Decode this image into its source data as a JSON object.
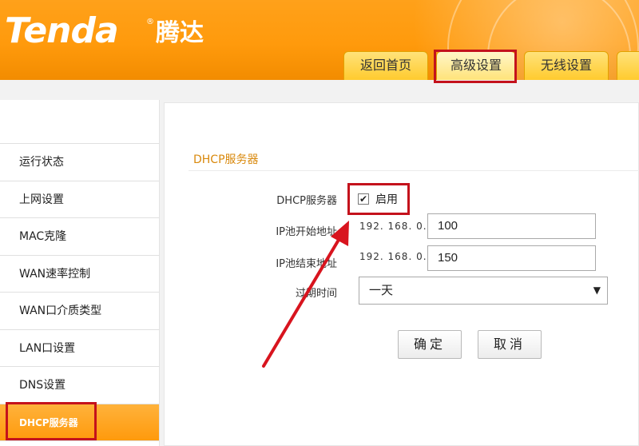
{
  "brand": {
    "logo_text": "Tenda",
    "logo_cn": "腾达",
    "reg_mark": "®"
  },
  "tabs": [
    {
      "label": "返回首页",
      "active": false
    },
    {
      "label": "高级设置",
      "active": true
    },
    {
      "label": "无线设置",
      "active": false
    },
    {
      "label": "",
      "active": false
    }
  ],
  "sidebar": {
    "items": [
      {
        "label": "运行状态"
      },
      {
        "label": "上网设置"
      },
      {
        "label": "MAC克隆"
      },
      {
        "label": "WAN速率控制"
      },
      {
        "label": "WAN口介质类型"
      },
      {
        "label": "LAN口设置"
      },
      {
        "label": "DNS设置"
      },
      {
        "label": "DHCP服务器",
        "active": true
      }
    ]
  },
  "main": {
    "section_title": "DHCP服务器",
    "dhcp_label": "DHCP服务器",
    "enable_label": "启用",
    "enable_checked": true,
    "ip_start_label": "IP池开始地址",
    "ip_end_label": "IP池结束地址",
    "ip_prefix": "192. 168. 0.",
    "ip_start_value": "100",
    "ip_end_value": "150",
    "lease_label": "过期时间",
    "lease_value": "一天",
    "ok_button": "确定",
    "cancel_button": "取消"
  },
  "colors": {
    "brand_orange": "#ff9a0c",
    "highlight_red": "#c4121c",
    "title_orange": "#d9890d"
  }
}
